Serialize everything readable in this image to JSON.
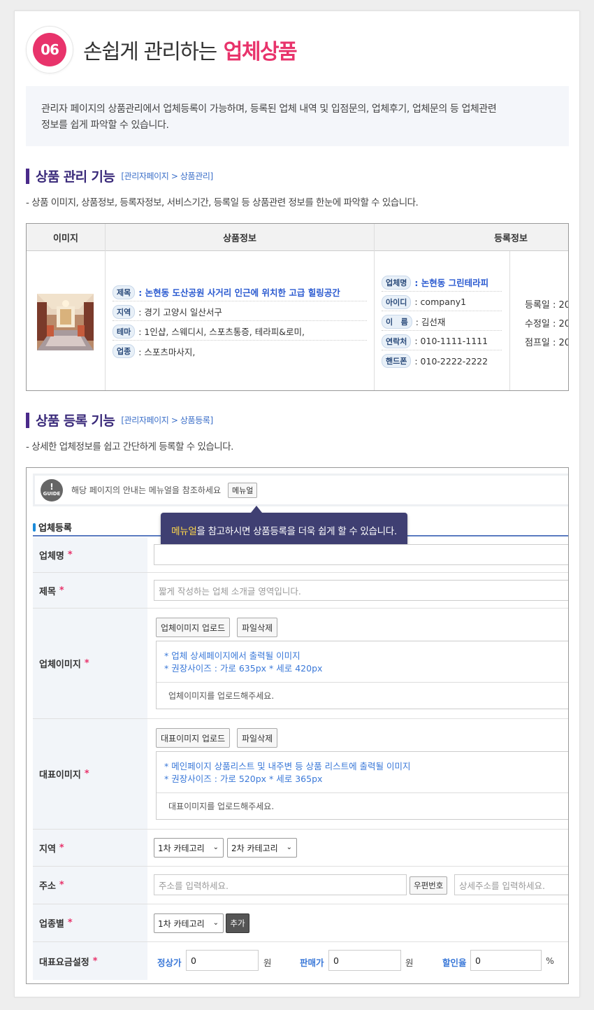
{
  "header": {
    "number": "06",
    "title": "손쉽게 관리하는",
    "title_highlight": "업체상품"
  },
  "intro": {
    "line1": "관리자 페이지의 상품관리에서 업체등록이 가능하며, 등록된 업체 내역 및 입점문의, 업체후기, 업체문의 등 업체관련",
    "line2": "정보를 쉽게 파악할 수 있습니다."
  },
  "section1": {
    "title": "상품 관리 기능",
    "path": "[관리자페이지 > 상품관리]",
    "desc": "- 상품 이미지, 상품정보, 등록자정보, 서비스기간, 등록일 등 상품관련 정보를 한눈에 파악할 수 있습니다."
  },
  "product_table": {
    "headers": [
      "이미지",
      "상품정보",
      "등록정보"
    ],
    "product_info": [
      {
        "chip": "제목",
        "value": ": 논현동 도산공원 사거리 인근에 위치한 고급 힐링공간",
        "highlight": true
      },
      {
        "chip": "지역",
        "value": ": 경기 고양시 일산서구",
        "highlight": false
      },
      {
        "chip": "테마",
        "value": ": 1인샵, 스웨디시, 스포츠통증, 테라피&로미,",
        "highlight": false
      },
      {
        "chip": "업종",
        "value": ": 스포츠마사지,",
        "highlight": false
      }
    ],
    "registrant": [
      {
        "chip": "업체명",
        "value": ": 논현동 그린테라피",
        "highlight": true
      },
      {
        "chip": "아이디",
        "value": ": company1",
        "highlight": false
      },
      {
        "chip": "이   름",
        "value": ": 김선재",
        "highlight": false
      },
      {
        "chip": "연락처",
        "value": ": 010-1111-1111",
        "highlight": false
      },
      {
        "chip": "핸드폰",
        "value": ": 010-2222-2222",
        "highlight": false
      }
    ],
    "dates": [
      "등록일 : 20",
      "수정일 : 20",
      "점프일 : 20"
    ]
  },
  "section2": {
    "title": "상품 등록 기능",
    "path": "[관리자페이지 > 상품등록]",
    "desc": "- 상세한 업체정보를 쉽고 간단하게 등록할 수 있습니다."
  },
  "form": {
    "guide_icon_text": "GUIDE",
    "guide_text": "해당 페이지의 안내는 메뉴얼을 참조하세요",
    "manual_button": "메뉴얼",
    "tooltip_highlight": "메뉴얼",
    "tooltip_rest": "을 참고하시면 상품등록을 더욱 쉽게 할 수 있습니다.",
    "section_label": "업체등록",
    "required_mark": "*",
    "fields": {
      "company_name": {
        "label": "업체명",
        "value": ""
      },
      "title": {
        "label": "제목",
        "placeholder": "짧게 작성하는 업체 소개글 영역입니다."
      },
      "company_image": {
        "label": "업체이미지",
        "upload_button": "업체이미지 업로드",
        "delete_button": "파일삭제",
        "note1": "* 업체 상세페이지에서 출력될 이미지",
        "note2": "* 권장사이즈 : 가로 635px * 세로 420px",
        "message": "업체이미지를 업로드해주세요."
      },
      "main_image": {
        "label": "대표이미지",
        "upload_button": "대표이미지 업로드",
        "delete_button": "파일삭제",
        "note1": "* 메인페이지 상품리스트 및 내주변 등 상품 리스트에 출력될 이미지",
        "note2": "* 권장사이즈 : 가로 520px * 세로 365px",
        "message": "대표이미지를 업로드해주세요."
      },
      "region": {
        "label": "지역",
        "select1": "1차 카테고리",
        "select2": "2차 카테고리"
      },
      "address": {
        "label": "주소",
        "placeholder": "주소를 입력하세요.",
        "zip_button": "우편번호",
        "detail_placeholder": "상세주소를 입력하세요."
      },
      "business_type": {
        "label": "업종별",
        "select1": "1차 카테고리",
        "add_button": "추가"
      },
      "price": {
        "label": "대표요금설정",
        "regular_label": "정상가",
        "regular_value": "0",
        "regular_unit": "원",
        "sale_label": "판매가",
        "sale_value": "0",
        "sale_unit": "원",
        "discount_label": "할인율",
        "discount_value": "0",
        "discount_unit": "%"
      }
    }
  },
  "colors": {
    "accent_pink": "#e8336b",
    "section_purple": "#3a2a7a",
    "link_blue": "#2a5ad0",
    "tooltip_bg": "#3f3f72"
  }
}
